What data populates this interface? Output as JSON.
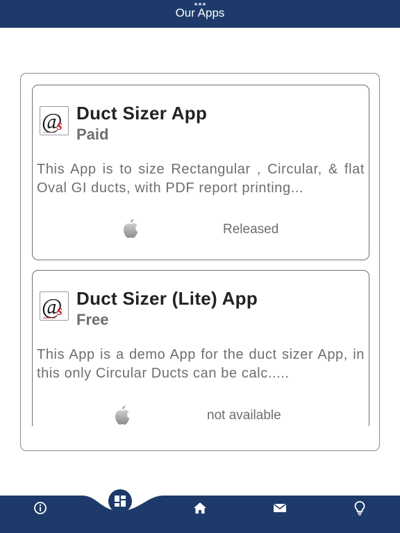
{
  "header": {
    "title": "Our Apps"
  },
  "apps": [
    {
      "name": "Duct Sizer App",
      "price": "Paid",
      "description": "This App is to size Rectangular , Circular, & flat Oval GI ducts, with PDF report printing...",
      "platform_icon": "apple-icon",
      "status": "Released"
    },
    {
      "name": "Duct Sizer (Lite) App",
      "price": "Free",
      "description": "This App is a demo App for the duct sizer App, in this only Circular Ducts can be calc.....",
      "platform_icon": "apple-icon",
      "status": "not available"
    }
  ],
  "tabbar": {
    "items": [
      "info-icon",
      "apps-grid-icon",
      "home-icon",
      "mail-icon",
      "lightbulb-icon"
    ],
    "active": "apps-grid-icon"
  },
  "colors": {
    "brand": "#1d3a6a",
    "text_gray": "#6e6e6e",
    "logo_red": "#d4202a"
  }
}
